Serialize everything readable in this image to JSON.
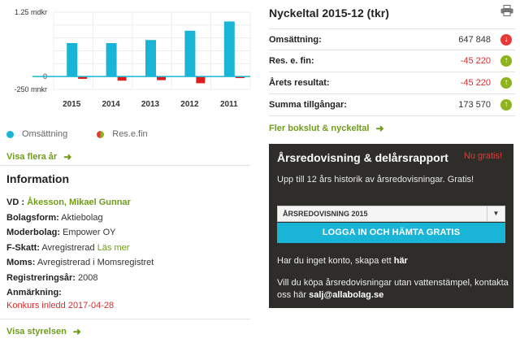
{
  "chart_data": {
    "type": "bar",
    "categories": [
      "2015",
      "2014",
      "2013",
      "2012",
      "2011"
    ],
    "series": [
      {
        "name": "Omsättning",
        "values": [
          0.65,
          0.65,
          0.71,
          0.89,
          1.07
        ],
        "color": "#1ab5d6"
      },
      {
        "name": "Res.e.fin",
        "values": [
          -0.045,
          -0.08,
          -0.07,
          -0.13,
          -0.03
        ],
        "color": "#e01b1b"
      }
    ],
    "ytick_labels": [
      "1.25 mdkr",
      "0",
      "-250 mnkr"
    ],
    "ylim": [
      -0.25,
      1.25
    ],
    "grid": true,
    "legend_position": "bottom-left"
  },
  "chart": {
    "legend": {
      "omsattning": "Omsättning",
      "resefin": "Res.e.fin"
    }
  },
  "links": {
    "visa_flera_ar": "Visa flera år",
    "visa_styrelsen": "Visa styrelsen",
    "fler_bokslut": "Fler bokslut & nyckeltal"
  },
  "information": {
    "title": "Information",
    "vd_label": "VD :",
    "vd_value": "Åkesson, Mikael Gunnar",
    "bolagsform_label": "Bolagsform:",
    "bolagsform_value": "Aktiebolag",
    "moderbolag_label": "Moderbolag:",
    "moderbolag_value": "Empower OY",
    "fskatt_label": "F-Skatt:",
    "fskatt_value": "Avregistrerad",
    "fskatt_link": "Läs mer",
    "moms_label": "Moms:",
    "moms_value": "Avregistrerad i Momsregistret",
    "regar_label": "Registreringsår:",
    "regar_value": "2008",
    "anmarkning_label": "Anmärkning:",
    "anmarkning_value": "Konkurs inledd 2017-04-28"
  },
  "nyckeltal": {
    "title": "Nyckeltal 2015-12 (tkr)",
    "rows": [
      {
        "label": "Omsättning:",
        "value": "647 848",
        "trend": "down"
      },
      {
        "label": "Res. e. fin:",
        "value": "-45 220",
        "trend": "up"
      },
      {
        "label": "Årets resultat:",
        "value": "-45 220",
        "trend": "up"
      },
      {
        "label": "Summa tillgångar:",
        "value": "173 570",
        "trend": "up"
      }
    ]
  },
  "report_box": {
    "title": "Årsredovisning & delårsrapport",
    "badge": "Nu gratis!",
    "subtitle": "Upp till 12 års historik av årsredovisningar. Gratis!",
    "select_value": "ÅRSREDOVISNING 2015",
    "cta": "LOGGA IN OCH HÄMTA GRATIS",
    "no_account_text": "Har du inget konto, skapa ett",
    "no_account_link": "här",
    "buy_text": "Vill du köpa årsredovisningar utan vattenstämpel, kontakta oss här",
    "buy_email": "salj@allabolag.se"
  },
  "icons": {
    "printer": "printer-icon",
    "arrow": "arrow-right-icon",
    "trend_down": "arrow-down-circle-icon",
    "trend_up": "arrow-up-circle-icon",
    "caret": "chevron-down-icon"
  }
}
